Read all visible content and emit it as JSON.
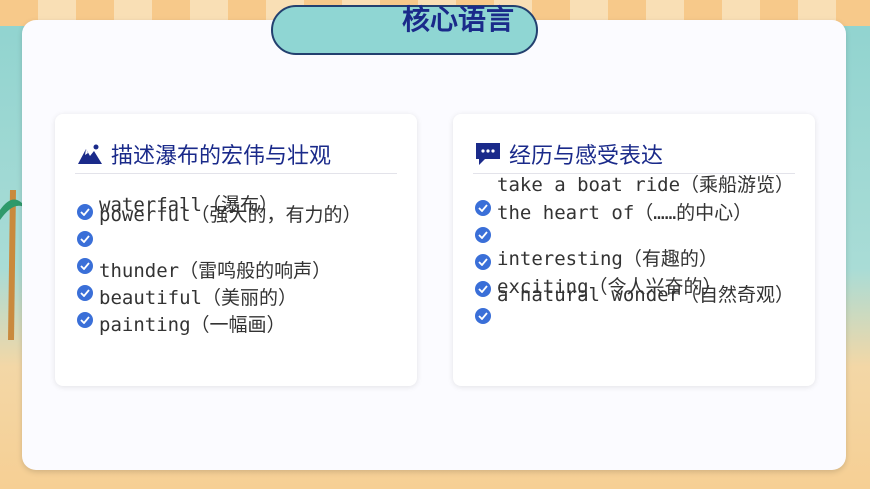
{
  "title": "核心语言",
  "left_panel": {
    "heading": "描述瀑布的宏伟与壮观",
    "items": [
      "waterfall（瀑布）",
      "powerful（强大的，有力的）",
      "thunder（雷鸣般的响声）",
      "beautiful（美丽的）",
      "painting（一幅画）"
    ],
    "icon": "mountain-icon"
  },
  "right_panel": {
    "heading": "经历与感受表达",
    "items": [
      "take a boat ride（乘船游览）",
      "the heart of（……的中心）",
      "interesting（有趣的）",
      "exciting（令人兴奋的）",
      "a natural wonder（自然奇观）"
    ],
    "icon": "chat-bubble-icon"
  },
  "colors": {
    "heading": "#1a2a8a",
    "bullet": "#3a6fd8",
    "pill": "#8fd6d3"
  }
}
